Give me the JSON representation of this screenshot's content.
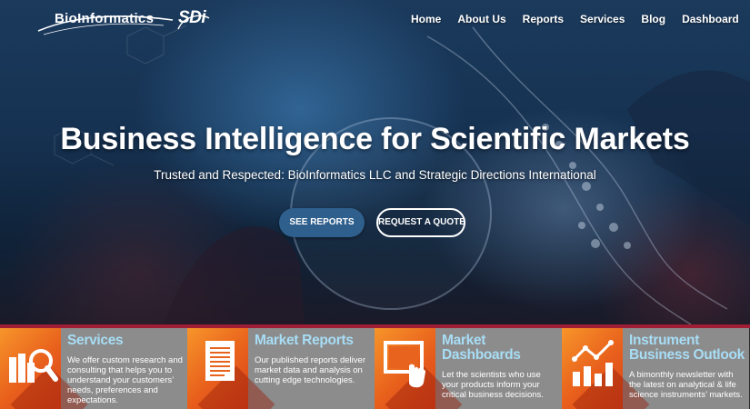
{
  "brand": {
    "logo_text": "BioInformatics",
    "partner_logo_text": "SDi"
  },
  "nav": {
    "items": [
      "Home",
      "About Us",
      "Reports",
      "Services",
      "Blog",
      "Dashboard"
    ],
    "search_icon": "search-icon"
  },
  "hero": {
    "headline": "Business Intelligence for Scientific Markets",
    "subline": "Trusted and Respected: BioInformatics LLC and Strategic Directions International",
    "primary_button": "SEE REPORTS",
    "secondary_button": "REQUEST A QUOTE"
  },
  "features": [
    {
      "title": "Services",
      "description": "We offer custom research and consulting that helps you to understand your customers’ needs, preferences and expectations.",
      "icon": "book-magnifier-icon"
    },
    {
      "title": "Market Reports",
      "description": "Our published reports deliver market data and analysis on cutting edge technologies.",
      "icon": "document-icon"
    },
    {
      "title": "Market Dashboards",
      "description": "Let the scientists who use your products inform your critical business decisions.",
      "icon": "dashboard-touch-icon"
    },
    {
      "title": "Instrument Business Outlook",
      "description": "A bimonthly newsletter with the latest on analytical & life science instruments’ markets.",
      "icon": "bar-chart-trend-icon"
    }
  ],
  "colors": {
    "accent_blue": "#2f5f8c",
    "divider_red": "#a01d36",
    "feature_title": "#a7ddf5",
    "icon_orange": "#f7952a",
    "feature_bg": "#8c8c8c"
  }
}
